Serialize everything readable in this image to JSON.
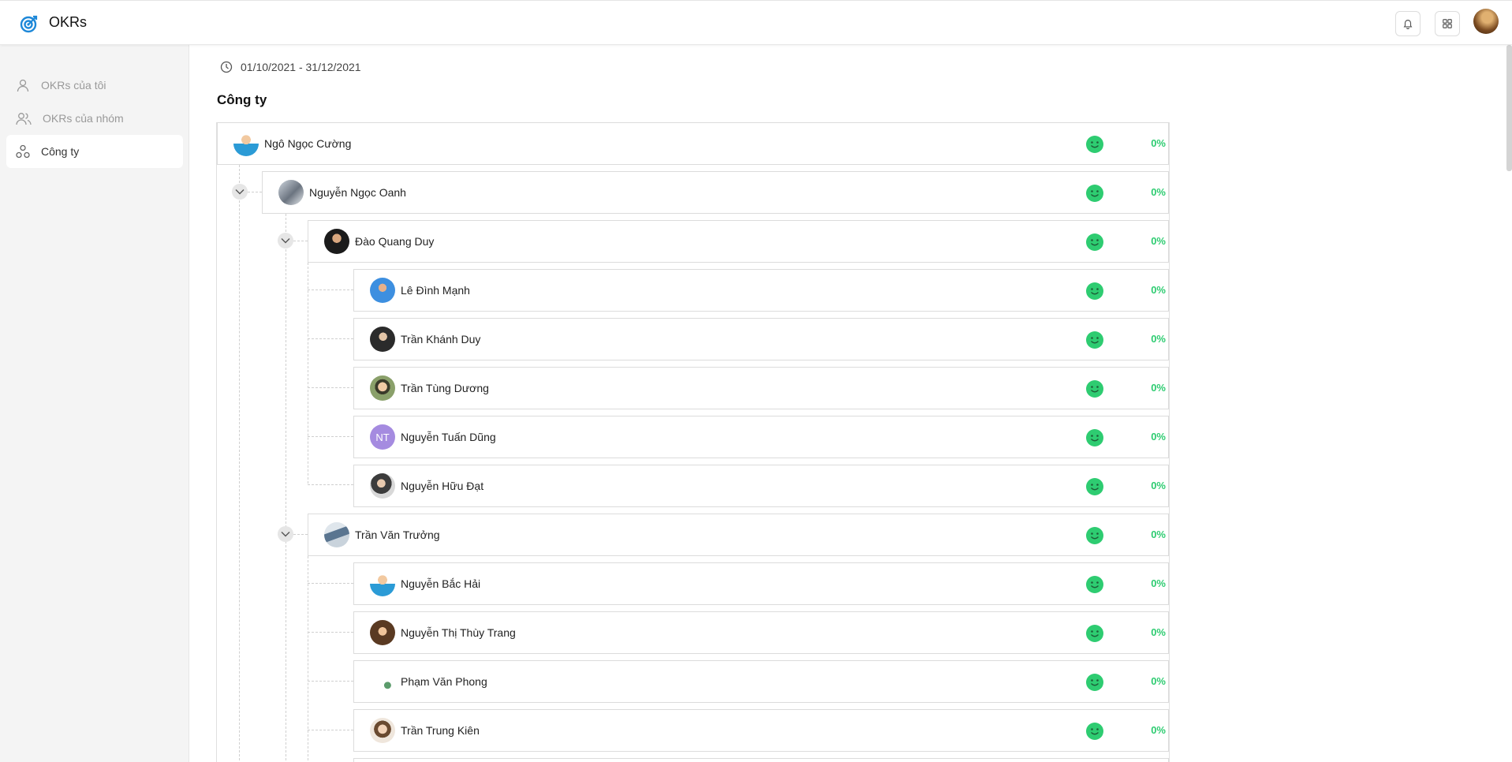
{
  "app": {
    "title": "OKRs",
    "brand_color": "#1e88d8"
  },
  "header": {
    "icons": [
      "bell-icon",
      "grid-icon"
    ],
    "avatar": "user-avatar"
  },
  "sidebar": {
    "items": [
      {
        "label": "OKRs của tôi",
        "icon": "user-icon",
        "active": false
      },
      {
        "label": "OKRs của nhóm",
        "icon": "users-icon",
        "active": false
      },
      {
        "label": "Công ty",
        "icon": "org-icon",
        "active": true
      }
    ]
  },
  "period": {
    "date_range": "01/10/2021 - 31/12/2021"
  },
  "section": {
    "title": "Công ty"
  },
  "status_color": "#2ecc71",
  "tree": [
    {
      "name": "Ngô Ngọc Cường",
      "progress": "0%",
      "level": 0
    },
    {
      "name": "Nguyễn Ngọc Oanh",
      "progress": "0%",
      "level": 1
    },
    {
      "name": "Đào Quang Duy",
      "progress": "0%",
      "level": 2
    },
    {
      "name": "Lê Đình Mạnh",
      "progress": "0%",
      "level": 3
    },
    {
      "name": "Trần Khánh Duy",
      "progress": "0%",
      "level": 3
    },
    {
      "name": "Trần Tùng Dương",
      "progress": "0%",
      "level": 3
    },
    {
      "name": "Nguyễn Tuấn Dũng",
      "progress": "0%",
      "level": 3,
      "initials": "NT"
    },
    {
      "name": "Nguyễn Hữu Đạt",
      "progress": "0%",
      "level": 3
    },
    {
      "name": "Trần Văn Trưởng",
      "progress": "0%",
      "level": 2
    },
    {
      "name": "Nguyễn Bắc Hải",
      "progress": "0%",
      "level": 3
    },
    {
      "name": "Nguyễn Thị Thùy Trang",
      "progress": "0%",
      "level": 3
    },
    {
      "name": "Phạm Văn Phong",
      "progress": "0%",
      "level": 3
    },
    {
      "name": "Trần Trung Kiên",
      "progress": "0%",
      "level": 3
    }
  ]
}
